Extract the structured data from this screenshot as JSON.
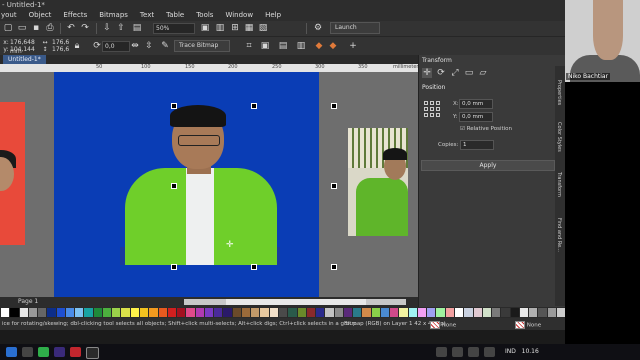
{
  "window": {
    "title": "- Untitled-1*",
    "controls": [
      "—",
      "❐",
      "✕"
    ]
  },
  "menu": [
    "yout",
    "Object",
    "Effects",
    "Bitmaps",
    "Text",
    "Table",
    "Tools",
    "Window",
    "Help"
  ],
  "toolbar1": {
    "zoom": "50%",
    "launch_label": "Launch"
  },
  "toolbar2": {
    "x": "176,648 mm",
    "y": "104,144 mm",
    "w": "176,6",
    "h": "176,6",
    "angle": "0,0",
    "trace_bitmap": "Trace Bitmap"
  },
  "document": {
    "tab": "Untitled-1*",
    "page_tab": "Page 1",
    "ruler_ticks": [
      "50",
      "100",
      "150",
      "200",
      "250",
      "300",
      "350"
    ],
    "ruler_unit": "millimeters"
  },
  "docker": {
    "title": "Transform",
    "section": "Position",
    "x_label": "X:",
    "x_value": "0,0 mm",
    "y_label": "Y:",
    "y_value": "0,0 mm",
    "relative_position": "Relative Position",
    "copies_label": "Copies:",
    "copies_value": "1",
    "apply": "Apply",
    "side_tabs": [
      "Properties",
      "Color Styles",
      "Transform",
      "Find and Re..."
    ]
  },
  "status": {
    "hint": "ice for rotating/skewing; dbl-clicking tool selects all objects; Shift+click multi-selects; Alt+click digs; Ctrl+click selects in a group",
    "object": "Bitmap (RGB) on Layer 1 42 x 42 dpi",
    "fill": "None",
    "outline": "None"
  },
  "webcam": {
    "name": "Niko Bachtiar"
  },
  "taskbar": {
    "lang": "IND",
    "time": "10.16"
  },
  "palette_colors": [
    "#ffffff",
    "#000000",
    "#e6e6e6",
    "#999999",
    "#666666",
    "#0d2e8a",
    "#1e4fd1",
    "#4a8ce8",
    "#7ec2f2",
    "#19a3a3",
    "#1f8a3a",
    "#4cb03e",
    "#9bd24a",
    "#d9e04a",
    "#fff24a",
    "#f2c21f",
    "#f29a1f",
    "#e85a1f",
    "#d11f1f",
    "#a3101f",
    "#e04a8a",
    "#b03ab0",
    "#7a3ac2",
    "#4a2a9a",
    "#2a1a6a",
    "#6a4a2a",
    "#9a6a3a",
    "#c29a6a",
    "#e8c9a0",
    "#f2e0c9",
    "#4a4a4a",
    "#2a5a4a",
    "#6a8a2a",
    "#8a2a2a",
    "#2a2a8a",
    "#c2c2c2",
    "#8a8a8a",
    "#5a2a7a",
    "#2a7a8a",
    "#d18a4a",
    "#8ad14a",
    "#4a8ad1",
    "#d14a8a",
    "#f2f2a0",
    "#a0f2f2",
    "#f2a0f2",
    "#a0a0f2",
    "#a0f2a0",
    "#f2a0a0",
    "#ffffff",
    "#c9d1e0",
    "#e0c9d1",
    "#d1e0c9",
    "#7a7a7a",
    "#3a3a3a",
    "#1a1a1a",
    "#e8e8e8",
    "#b0b0b0",
    "#555555",
    "#9a9a9a",
    "#cccccc"
  ]
}
